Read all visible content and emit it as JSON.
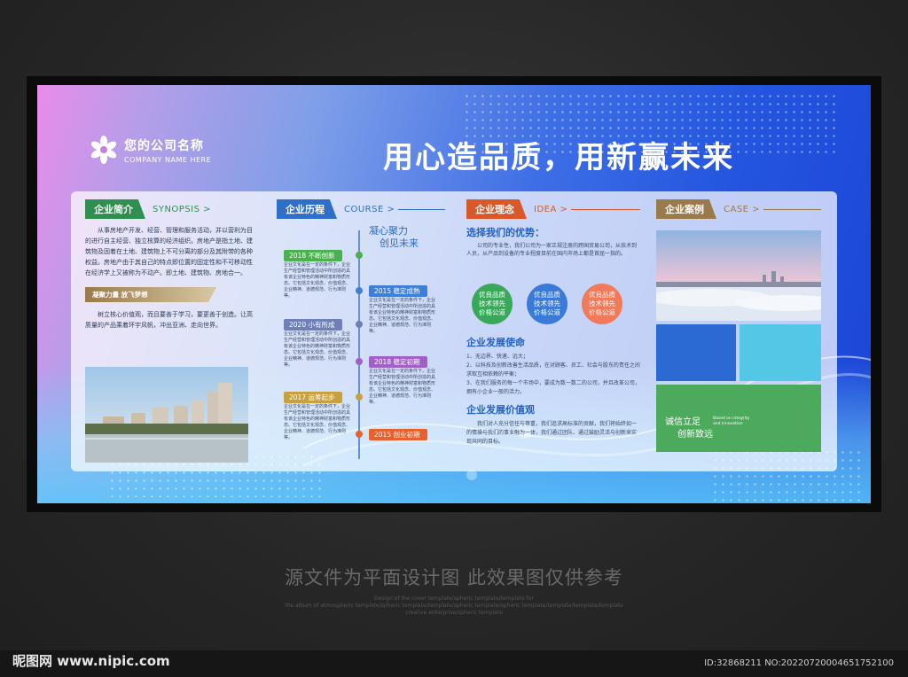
{
  "company": {
    "name_cn": "您的公司名称",
    "name_en": "COMPANY NAME HERE",
    "logo_icon": "flower-logo-icon"
  },
  "slogan": "用心造品质，用新赢未来",
  "synopsis": {
    "title": "企业简介",
    "en": "SYNOPSIS >",
    "paragraph": "从事房地产开发、经营、管理和服务活动，并以营利为目的进行自主经营、独立核算的经济组织。房地产是指土地、建筑物及固着在土地、建筑物上不可分离的部分及其附带的各种权益。房地产由于其自己的特点即位置的固定性和不可移动性在经济学上又被称为不动产。即土地、建筑物、房地合一。",
    "subtitle": "凝聚力量 放飞梦想",
    "paragraph2": "树立核心价值观，而且要善于学习，要更善于创造。让高质量的产品乘着环宇风帆，冲出亚洲、走向世界。"
  },
  "course": {
    "title": "企业历程",
    "en": "COURSE >",
    "motto_line1": "凝心聚力",
    "motto_line2": "创见未来",
    "milestones": [
      {
        "label": "2018 不断创新",
        "side": "left",
        "color": "#4caf50",
        "text": "企业文化是在一定的条件下，企业生产经营和管理活动中所创造的具有该企业特色的精神财富和物质形态。它包括文化观念、价值观念、企业精神、道德规范、行为准则等。"
      },
      {
        "label": "2015 稳定成熟",
        "side": "right",
        "color": "#3f7fd8",
        "text": "企业文化是在一定的条件下，企业生产经营和管理活动中所创造的具有该企业特色的精神财富和物质形态。它包括文化观念、价值观念、企业精神、道德规范、行为准则等。"
      },
      {
        "label": "2020 小有所成",
        "side": "left",
        "color": "#6f7fb8",
        "text": "企业文化是在一定的条件下，企业生产经营和管理活动中所创造的具有该企业特色的精神财富和物质形态。它包括文化观念、价值观念、企业精神、道德规范、行为准则等。"
      },
      {
        "label": "2018 稳定初期",
        "side": "right",
        "color": "#a060c8",
        "text": "企业文化是在一定的条件下，企业生产经营和管理活动中所创造的具有该企业特色的精神财富和物质形态。它包括文化观念、价值观念、企业精神、道德规范、行为准则等。"
      },
      {
        "label": "2017 运筹起步",
        "side": "left",
        "color": "#c8a040",
        "text": "企业文化是在一定的条件下，企业生产经营和管理活动中所创造的具有该企业特色的精神财富和物质形态。它包括文化观念、价值观念、企业精神、道德规范、行为准则等。"
      },
      {
        "label": "2015 创业初期",
        "side": "right",
        "color": "#e8602c",
        "text": ""
      }
    ]
  },
  "idea": {
    "title": "企业理念",
    "en": "IDEA >",
    "advantage_title": "选择我们的优势：",
    "advantage_text": "公司的专业性，我们公司为一家正规注册的跨国贸易公司，从技术到人员，从产品到设备的专业程度目前在国内市场上都是首屈一指的。",
    "bubbles": [
      {
        "l1": "优良品质",
        "l2": "技术领先",
        "l3": "价格公道",
        "color": "#3aa85a"
      },
      {
        "l1": "优良品质",
        "l2": "技术领先",
        "l3": "价格公道",
        "color": "#3a7ad8"
      },
      {
        "l1": "优良品质",
        "l2": "技术领先",
        "l3": "价格公道",
        "color": "#f07a5a"
      }
    ],
    "mission_title": "企业发展使命",
    "mission_items": [
      "1、无边界、快速、远大；",
      "2、以科技及创新改善生活品质，在对顾客、员工、社会与股东的责任之间求取互相依赖的平衡；",
      "3、在我们服务的每一个市场中，要成为数一数二的公司，并且改革公司，拥有小企业一般的活力。"
    ],
    "values_title": "企业发展价值观",
    "values_text": "我们对人充分信任与尊重，我们追求高标准的贡献，我们将始终如一的情操与我们的事业融为一体，我们通过团队、通过鼓励灵活与创新来实现共同的目标。"
  },
  "case": {
    "title": "企业案例",
    "en": "CASE >",
    "tile_cn_1": "诚信立足",
    "tile_cn_2": "创新致远",
    "tile_en_1": "Based on integrity",
    "tile_en_2": "and innovation",
    "colors": {
      "blue": "#2a6ad2",
      "cyan": "#54c6e6",
      "green": "#4caa5c"
    }
  },
  "colors": {
    "green": "#2f8f4e",
    "blue": "#2f6fc8",
    "orange": "#d8582a",
    "brown": "#9a7a4a",
    "heading_blue": "#2160c8"
  },
  "caption": "源文件为平面设计图 此效果图仅供参考",
  "caption_en_1": "Design of the cover template/spheric template/template for",
  "caption_en_2": "the album of atmospheric template/spheric template/template/spheric template/spheric template/template/template/template",
  "caption_en_3": "creative enterprise/spheric template",
  "footer": {
    "site": "昵图网 www.nipic.com",
    "id": "ID:32868211 NO:20220720004651752100"
  }
}
